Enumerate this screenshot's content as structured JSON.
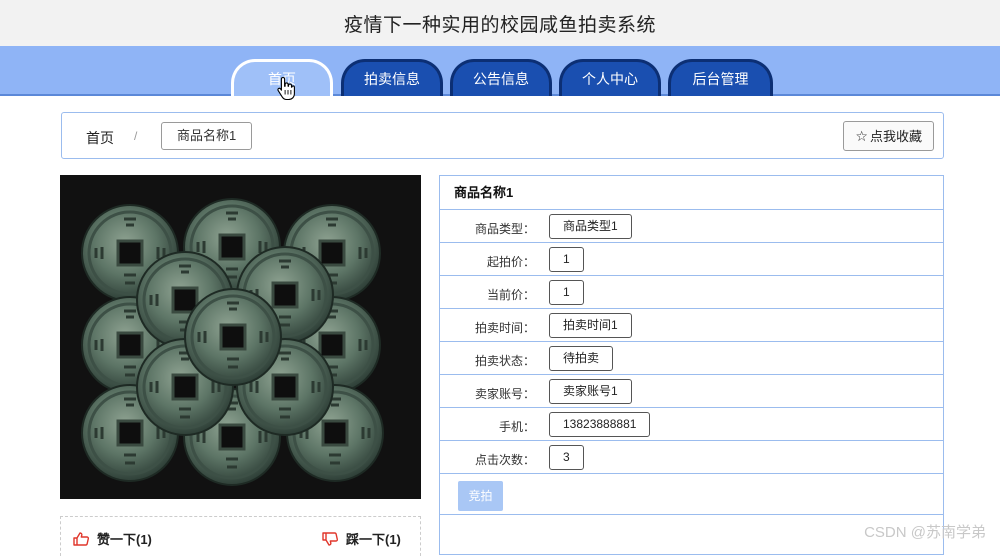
{
  "header": {
    "title": "疫情下一种实用的校园咸鱼拍卖系统"
  },
  "nav": {
    "tabs": [
      {
        "label": "首页",
        "active": true
      },
      {
        "label": "拍卖信息",
        "active": false
      },
      {
        "label": "公告信息",
        "active": false
      },
      {
        "label": "个人中心",
        "active": false
      },
      {
        "label": "后台管理",
        "active": false
      }
    ]
  },
  "breadcrumb": {
    "home": "首页",
    "separator": "/",
    "current": "商品名称1"
  },
  "favorite": {
    "icon": "star-outline-icon",
    "label": "点我收藏"
  },
  "product": {
    "image_alt": "coins",
    "title": "商品名称1",
    "fields": [
      {
        "label": "商品类型：",
        "value": "商品类型1"
      },
      {
        "label": "起拍价：",
        "value": "1"
      },
      {
        "label": "当前价：",
        "value": "1"
      },
      {
        "label": "拍卖时间：",
        "value": "拍卖时间1"
      },
      {
        "label": "拍卖状态：",
        "value": "待拍卖"
      },
      {
        "label": "卖家账号：",
        "value": "卖家账号1"
      },
      {
        "label": "手机：",
        "value": "13823888881"
      },
      {
        "label": "点击次数：",
        "value": "3"
      }
    ],
    "bid_label": "竞拍"
  },
  "votes": {
    "like": {
      "icon": "thumbs-up-icon",
      "label": "赞一下(1)"
    },
    "dislike": {
      "icon": "thumbs-down-icon",
      "label": "踩一下(1)"
    }
  },
  "watermark": "CSDN @苏南学弟",
  "colors": {
    "nav_bg": "#8fb4f6",
    "tab_bg": "#1a4fb0",
    "accent_red": "#e0362b",
    "border": "#9bbcee"
  }
}
